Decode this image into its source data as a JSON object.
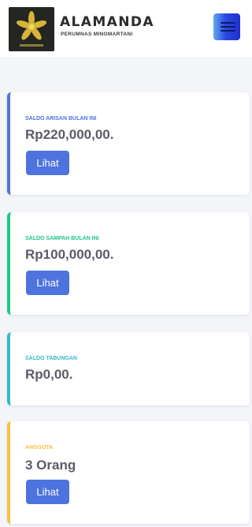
{
  "header": {
    "brand_name": "ALAMANDA",
    "brand_subtitle": "PERUMNAS MINOMARTANI",
    "logo_icon": "star-flower-logo-icon",
    "menu_icon": "hamburger-menu-icon"
  },
  "cards": [
    {
      "label": "SALDO ARISAN BULAN INI",
      "value": "Rp220,000,00.",
      "button_label": "Lihat",
      "accent_color": "#4e73df"
    },
    {
      "label": "SALDO SAMPAH BULAN INI",
      "value": "Rp100,000,00.",
      "button_label": "Lihat",
      "accent_color": "#1cc88a"
    },
    {
      "label": "SALDO TABUNGAN",
      "value": "Rp0,00.",
      "accent_color": "#36b9cc"
    },
    {
      "label": "ANGGOTA",
      "value": "3 Orang",
      "button_label": "Lihat",
      "accent_color": "#f6c23e"
    }
  ],
  "colors": {
    "button": "#4e73df",
    "value_text": "#5a5c69",
    "background": "#f4f5f9"
  }
}
